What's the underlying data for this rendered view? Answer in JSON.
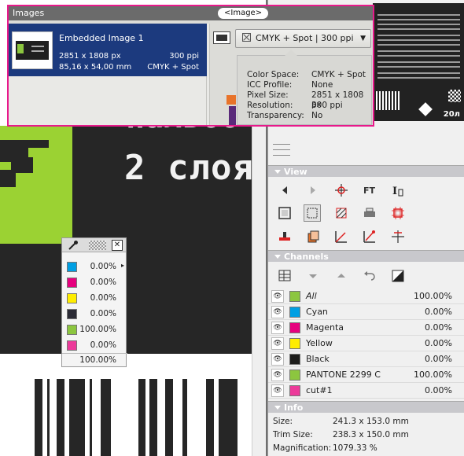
{
  "canvas": {
    "headline": "2 слоя",
    "headline_top": "пальоо"
  },
  "images_popup": {
    "title": "Images",
    "badge": "<Image>",
    "item": {
      "name": "Embedded Image 1",
      "pixels": "2851 x 1808 px",
      "ppi": "300 ppi",
      "size_mm": "85,16 x 54,00 mm",
      "colorspace": "CMYK + Spot"
    },
    "dropdown_label": "CMYK + Spot  |  300 ppi",
    "details": [
      {
        "label": "Color Space:",
        "value": "CMYK + Spot"
      },
      {
        "label": "ICC Profile:",
        "value": "None"
      },
      {
        "label": "Pixel Size:",
        "value": "2851 x 1808 px"
      },
      {
        "label": "Resolution:",
        "value": "300 ppi"
      },
      {
        "label": "Transparency:",
        "value": "No"
      }
    ]
  },
  "preview": {
    "number": "20л"
  },
  "view_panel": {
    "title": "View",
    "tools": [
      "prev-icon",
      "next-icon",
      "crosshair-icon",
      "text-frame-icon",
      "text-cursor-icon",
      "trim-box-icon",
      "crop-box-icon",
      "hatch-icon",
      "printer-icon",
      "bleed-box-icon",
      "stamp-icon",
      "layers-icon",
      "angle-icon",
      "angle-red-icon",
      "registration-icon"
    ]
  },
  "channels_panel": {
    "title": "Channels",
    "channels": [
      {
        "name": "All",
        "value": "100.00%",
        "color": "#8cc63f"
      },
      {
        "name": "Cyan",
        "value": "0.00%",
        "color": "#009fe3"
      },
      {
        "name": "Magenta",
        "value": "0.00%",
        "color": "#e6007e"
      },
      {
        "name": "Yellow",
        "value": "0.00%",
        "color": "#ffed00"
      },
      {
        "name": "Black",
        "value": "0.00%",
        "color": "#1d1d1b"
      },
      {
        "name": "PANTONE 2299 C",
        "value": "100.00%",
        "color": "#8cc63f"
      },
      {
        "name": "cut#1",
        "value": "0.00%",
        "color": "#ec3a9a"
      }
    ]
  },
  "info_panel": {
    "title": "Info",
    "rows": [
      {
        "label": "Size:",
        "value": "241.3 x 153.0 mm"
      },
      {
        "label": "Trim Size:",
        "value": "238.3 x 150.0 mm"
      },
      {
        "label": "Magnification:",
        "value": "1079.33 %"
      }
    ]
  },
  "separation_palette": {
    "rows": [
      {
        "value": "0.00%",
        "color": "#009fe3"
      },
      {
        "value": "0.00%",
        "color": "#e6007e"
      },
      {
        "value": "0.00%",
        "color": "#ffed00"
      },
      {
        "value": "0.00%",
        "color": "#2b2b35"
      },
      {
        "value": "100.00%",
        "color": "#8cc63f"
      },
      {
        "value": "0.00%",
        "color": "#ec3a9a"
      }
    ],
    "total": "100.00%"
  }
}
